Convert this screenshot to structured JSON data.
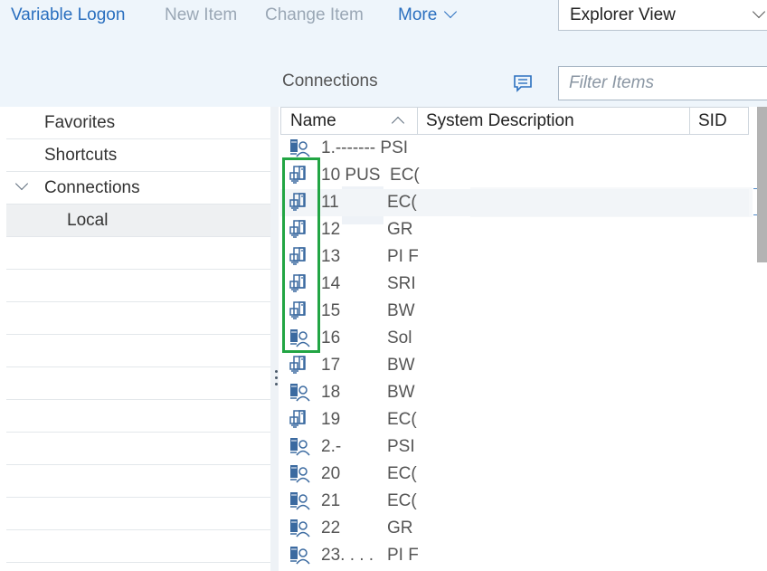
{
  "toolbar": {
    "variable_logon": "Variable Logon",
    "new_item": "New Item",
    "change_item": "Change Item",
    "more": "More"
  },
  "view_select": {
    "value": "Explorer View"
  },
  "connections_label": "Connections",
  "filter": {
    "placeholder": "Filter Items"
  },
  "sidebar": {
    "items": [
      {
        "label": "Favorites"
      },
      {
        "label": "Shortcuts"
      },
      {
        "label": "Connections"
      },
      {
        "label": "Local"
      }
    ]
  },
  "table": {
    "columns": [
      "Name",
      "System Description",
      "SID"
    ],
    "rows": [
      {
        "name": "1.------- PSI",
        "desc": "",
        "icon": "user-connection-icon"
      },
      {
        "name": "10 PUS  EC(",
        "desc": "",
        "icon": "server-connection-icon"
      },
      {
        "name": "11",
        "desc": "EC(",
        "icon": "server-connection-icon"
      },
      {
        "name": "12",
        "desc": "GR",
        "icon": "server-connection-icon"
      },
      {
        "name": "13",
        "desc": "PI F",
        "icon": "server-connection-icon"
      },
      {
        "name": "14",
        "desc": "SRI",
        "icon": "server-connection-icon"
      },
      {
        "name": "15",
        "desc": "BW",
        "icon": "server-connection-icon"
      },
      {
        "name": "16",
        "desc": "Sol",
        "icon": "user-connection-icon"
      },
      {
        "name": "17",
        "desc": "BW",
        "icon": "server-connection-icon"
      },
      {
        "name": "18",
        "desc": "BW",
        "icon": "user-connection-icon"
      },
      {
        "name": "19",
        "desc": "EC(",
        "icon": "server-connection-icon"
      },
      {
        "name": "2.-",
        "desc": "PSI",
        "icon": "user-connection-icon"
      },
      {
        "name": "20",
        "desc": "EC(",
        "icon": "user-connection-icon"
      },
      {
        "name": "21",
        "desc": "EC(",
        "icon": "user-connection-icon"
      },
      {
        "name": "22",
        "desc": "GR",
        "icon": "user-connection-icon"
      },
      {
        "name": "23. . . .",
        "desc": "PI F",
        "icon": "user-connection-icon"
      }
    ]
  }
}
